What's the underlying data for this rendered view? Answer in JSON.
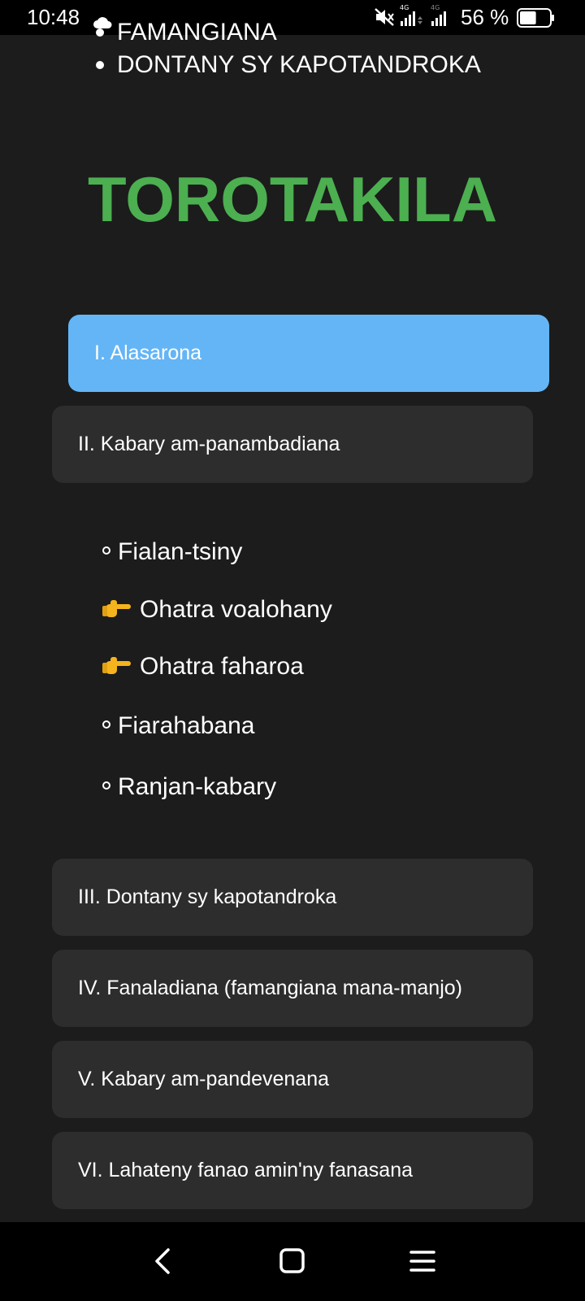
{
  "status_bar": {
    "time": "10:48",
    "network_1": "4G",
    "network_2": "4G",
    "battery_percent": "56 %",
    "battery_level": 0.56
  },
  "top_list": {
    "items": [
      "FAMANGIANA",
      "DONTANY SY KAPOTANDROKA"
    ]
  },
  "title": "TOROTAKILA",
  "sections": [
    {
      "label": "I. Alasarona",
      "active": true
    },
    {
      "label": "II. Kabary am-panambadiana",
      "active": false
    },
    {
      "label": "III. Dontany sy kapotandroka",
      "active": false
    },
    {
      "label": "IV. Fanaladiana (famangiana mana-manjo)",
      "active": false
    },
    {
      "label": "V. Kabary am-pandevenana",
      "active": false
    },
    {
      "label": "VI. Lahateny fanao amin'ny fanasana",
      "active": false
    }
  ],
  "sub_items": [
    {
      "label": "Fialan-tsiny",
      "bullet": "circle"
    },
    {
      "label": "Ohatra voalohany",
      "bullet": "hand-pointing-right-icon"
    },
    {
      "label": "Ohatra faharoa",
      "bullet": "hand-pointing-right-icon"
    },
    {
      "label": "Fiarahabana",
      "bullet": "circle"
    },
    {
      "label": "Ranjan-kabary",
      "bullet": "circle"
    }
  ],
  "colors": {
    "background": "#1c1c1c",
    "title": "#4caf50",
    "card": "#2d2d2d",
    "card_active": "#64b5f6"
  }
}
